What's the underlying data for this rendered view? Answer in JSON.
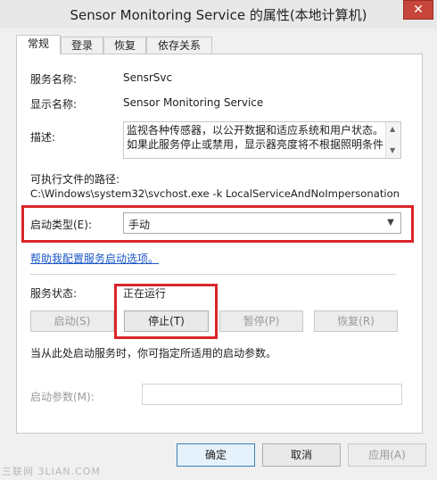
{
  "window": {
    "title": "Sensor Monitoring Service 的属性(本地计算机)",
    "close_label": "✕"
  },
  "tabs": [
    {
      "label": "常规",
      "active": true
    },
    {
      "label": "登录",
      "active": false
    },
    {
      "label": "恢复",
      "active": false
    },
    {
      "label": "依存关系",
      "active": false
    }
  ],
  "general": {
    "service_name_label": "服务名称:",
    "service_name": "SensrSvc",
    "display_name_label": "显示名称:",
    "display_name": "Sensor Monitoring Service",
    "description_label": "描述:",
    "description": "监视各种传感器，以公开数据和适应系统和用户状态。\n如果此服务停止或禁用，显示器亮度将不根据照明条件",
    "exe_path_label": "可执行文件的路径:",
    "exe_path": "C:\\Windows\\system32\\svchost.exe -k LocalServiceAndNoImpersonation",
    "startup_type_label": "启动类型(E):",
    "startup_type_value": "手动",
    "help_link": "帮助我配置服务启动选项。",
    "status_label": "服务状态:",
    "status_value": "正在运行",
    "start_button": "启动(S)",
    "stop_button": "停止(T)",
    "pause_button": "暂停(P)",
    "resume_button": "恢复(R)",
    "hint": "当从此处启动服务时，你可指定所适用的启动参数。",
    "params_label": "启动参数(M):",
    "params_value": ""
  },
  "footer": {
    "ok": "确定",
    "cancel": "取消",
    "apply": "应用(A)"
  },
  "watermark": "三联网 3LIAN.COM",
  "colors": {
    "highlight": "#d9252a",
    "link": "#1a56c6",
    "close": "#c7463c"
  }
}
